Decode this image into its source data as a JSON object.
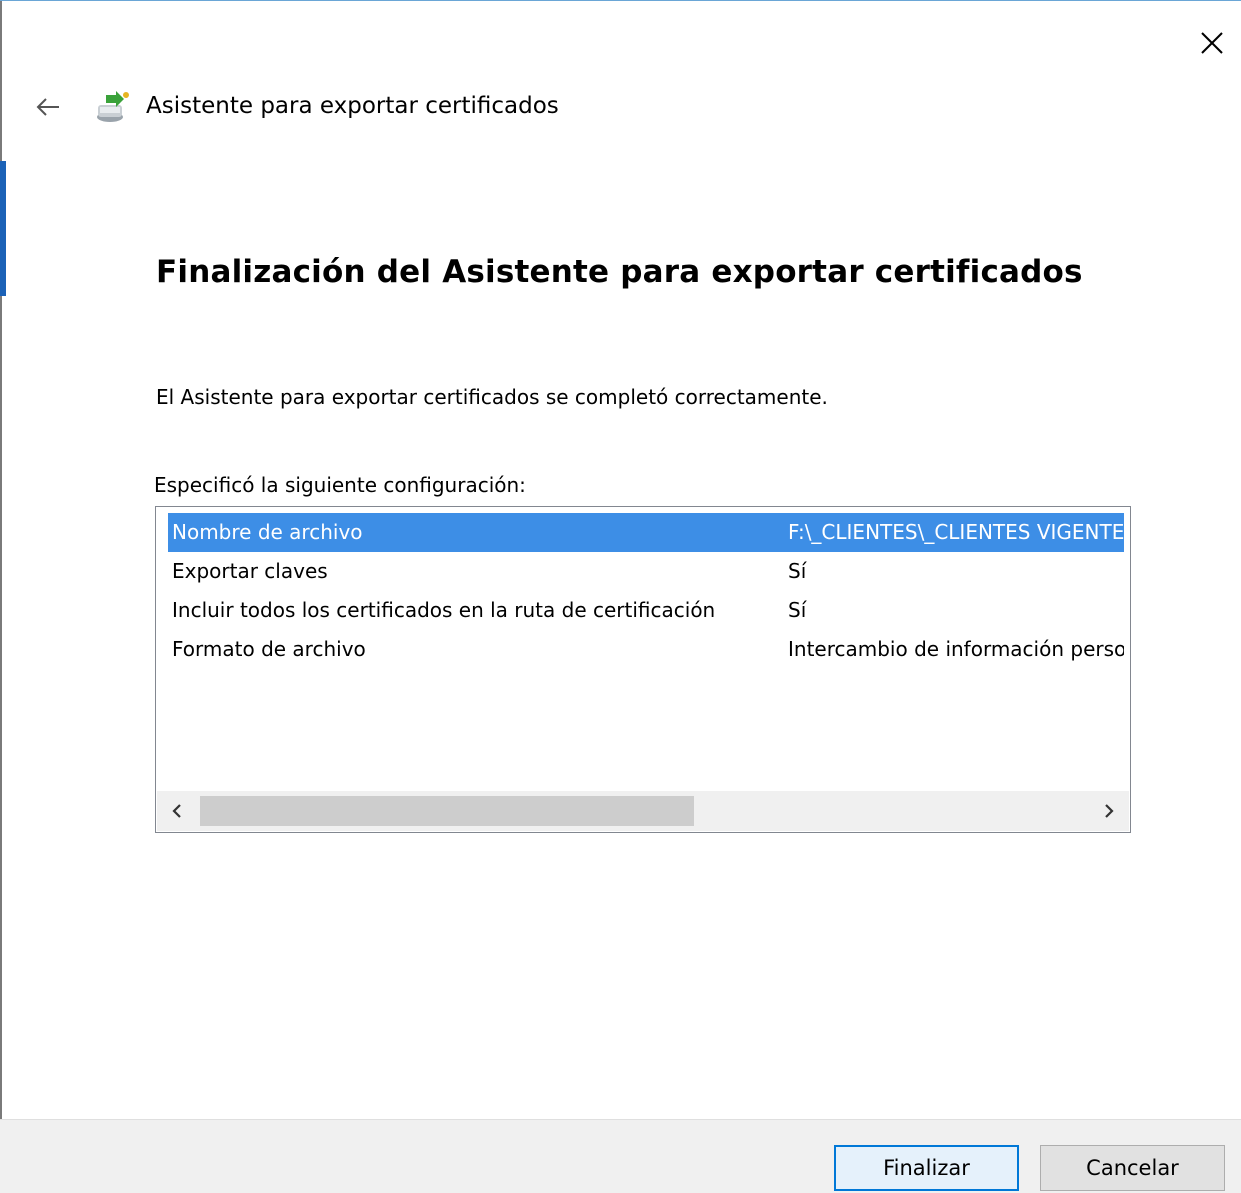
{
  "window": {
    "title": "Asistente para exportar certificados",
    "close_icon": "close-icon",
    "back_icon": "back-arrow-icon",
    "app_icon": "certificate-export-icon"
  },
  "main": {
    "heading": "Finalización del Asistente para exportar certificados",
    "status": "El Asistente para exportar certificados se completó correctamente.",
    "config_label": "Especificó la siguiente configuración:"
  },
  "settings": {
    "rows": [
      {
        "name": "Nombre de archivo",
        "value": "F:\\_CLIENTES\\_CLIENTES VIGENTES",
        "selected": true
      },
      {
        "name": "Exportar claves",
        "value": "Sí",
        "selected": false
      },
      {
        "name": "Incluir todos los certificados en la ruta de certificación",
        "value": "Sí",
        "selected": false
      },
      {
        "name": "Formato de archivo",
        "value": "Intercambio de información personal",
        "selected": false
      }
    ],
    "scroll_left_icon": "chevron-left-icon",
    "scroll_right_icon": "chevron-right-icon"
  },
  "footer": {
    "finish_label": "Finalizar",
    "cancel_label": "Cancelar"
  },
  "colors": {
    "selection": "#3d8ee6",
    "accent": "#0078d7",
    "footer_bg": "#f0f0f0"
  }
}
